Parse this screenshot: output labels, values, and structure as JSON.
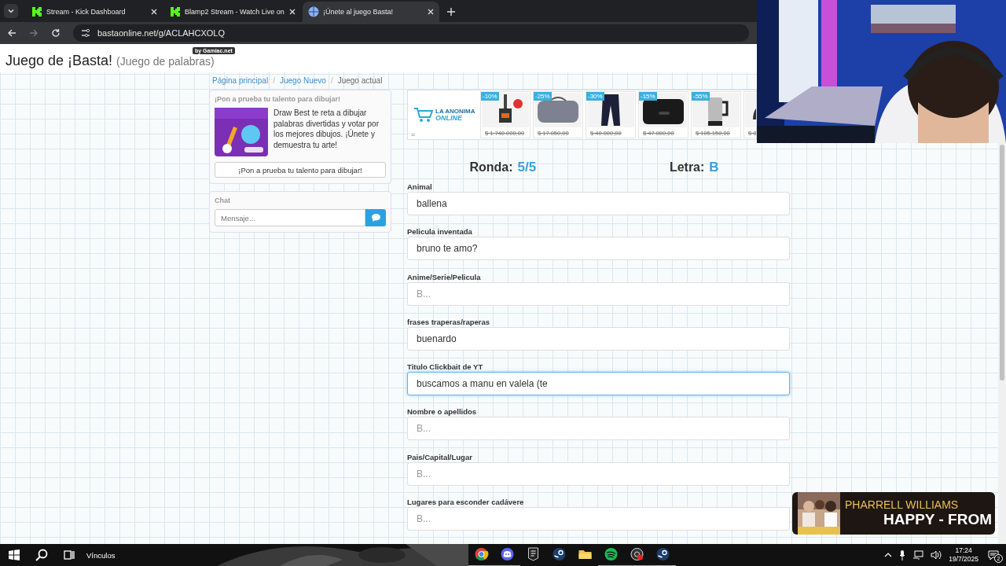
{
  "browser": {
    "tabs": [
      {
        "title": "Stream - Kick Dashboard",
        "selected": false
      },
      {
        "title": "Blamp2 Stream - Watch Live on",
        "selected": false
      },
      {
        "title": "¡Únete al juego Basta!",
        "selected": true
      }
    ],
    "url": "bastaonline.net/g/ACLAHCXOLQ"
  },
  "page": {
    "badge": "by Gamiac.net",
    "title": "Juego de ¡Basta!",
    "subtitle": "(Juego de palabras)",
    "breadcrumbs": [
      {
        "label": "Página principal",
        "kind": "link"
      },
      {
        "label": "Juego Nuevo",
        "kind": "link"
      },
      {
        "label": "Juego actual",
        "kind": "current"
      }
    ],
    "breadcrumb_separator": "/",
    "promo": {
      "heading": "¡Pon a prueba tu talento para dibujar!",
      "text": "Draw Best te reta a dibujar palabras divertidas y votar por los mejores dibujos. ¡Únete y demuestra tu arte!",
      "button": "¡Pon a prueba tu talento para dibujar!"
    },
    "chat": {
      "heading": "Chat",
      "placeholder": "Mensaje..."
    },
    "ad": {
      "logo_top": "LA ANONIMA",
      "logo_bottom": "ONLINE",
      "menu": "=",
      "products": [
        {
          "discount": "-10%",
          "price": "$ 1.740.000,00",
          "kind": "stove"
        },
        {
          "discount": "-25%",
          "price": "$ 17.050,00",
          "kind": "bag"
        },
        {
          "discount": "-30%",
          "price": "$ 40.000,00",
          "kind": "pants"
        },
        {
          "discount": "-15%",
          "price": "$ 47.000,00",
          "kind": "box"
        },
        {
          "discount": "-55%",
          "price": "$ 105.150,00",
          "kind": "kettle"
        },
        {
          "price": "$ 8",
          "kind": "iron"
        }
      ]
    },
    "round_label": "Ronda:",
    "round": "5/5",
    "letter_label": "Letra:",
    "letter": "B",
    "fields": [
      {
        "label": "Animal",
        "value": "ballena",
        "focused": false
      },
      {
        "label": "Pelicula inventada",
        "value": "bruno te amo?",
        "focused": false
      },
      {
        "label": "Anime/Serie/Pelicula",
        "placeholder": "B...",
        "focused": false
      },
      {
        "label": "frases traperas/raperas",
        "value": "buenardo",
        "focused": false
      },
      {
        "label": "Titulo Clickbait de YT",
        "value": "buscamos a manu en valela (te",
        "focused": true
      },
      {
        "label": "Nombre o apellidos",
        "placeholder": "B...",
        "focused": false
      },
      {
        "label": "Pais/Capital/Lugar",
        "placeholder": "B...",
        "focused": false
      },
      {
        "label": "Lugares para esconder cadávere",
        "placeholder": "B...",
        "focused": false
      }
    ]
  },
  "now_playing": {
    "artist": "PHARRELL WILLIAMS",
    "title": "HAPPY - FROM"
  },
  "taskbar": {
    "links": "Vínculos",
    "time": "17:24",
    "date": "19/7/2025",
    "notifications": "2"
  }
}
